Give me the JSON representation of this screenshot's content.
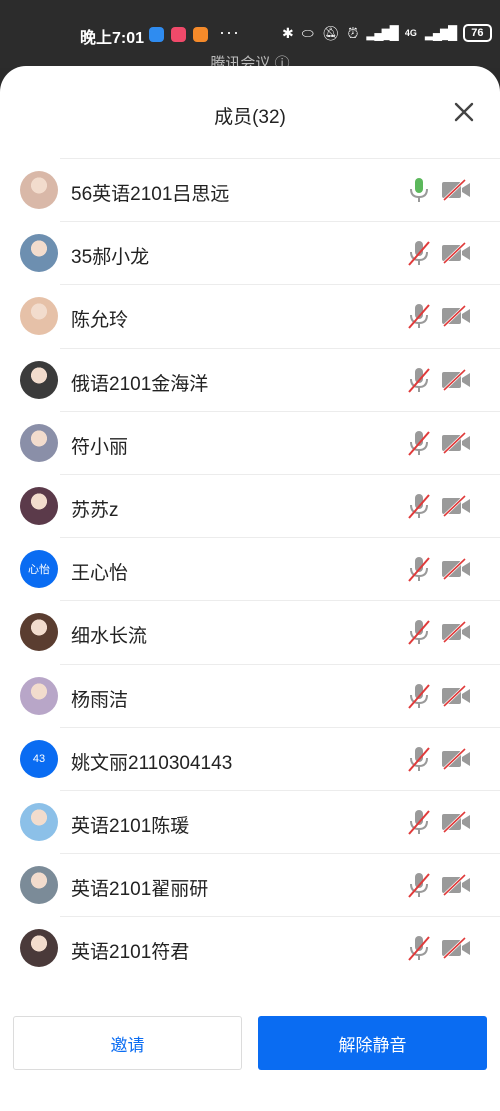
{
  "status_bar": {
    "time": "晚上7:01",
    "dots": "···",
    "network": "4G",
    "battery": "76"
  },
  "background_title": "腾讯会议 ⓘ",
  "panel": {
    "title": "成员(32)",
    "close_icon": "close-icon"
  },
  "members": [
    {
      "name": "56英语2101吕思远",
      "mic": "on",
      "camera": "off",
      "avatar_color": "#d9b8a8",
      "host_badge": true
    },
    {
      "name": "35郝小龙",
      "mic": "muted",
      "camera": "off",
      "avatar_color": "#6d8fb0"
    },
    {
      "name": "陈允玲",
      "mic": "muted",
      "camera": "off",
      "avatar_color": "#e6c1a8"
    },
    {
      "name": "俄语2101金海洋",
      "mic": "muted",
      "camera": "off",
      "avatar_color": "#3b3b3b"
    },
    {
      "name": "符小丽",
      "mic": "muted",
      "camera": "off",
      "avatar_color": "#8a8fa8"
    },
    {
      "name": "苏苏z",
      "mic": "muted",
      "camera": "off",
      "avatar_color": "#5b3a4a"
    },
    {
      "name": "王心怡",
      "mic": "muted",
      "camera": "off",
      "avatar_text": "心怡",
      "avatar_color": "#0a6cf2"
    },
    {
      "name": "细水长流",
      "mic": "muted",
      "camera": "off",
      "avatar_color": "#5a3d30"
    },
    {
      "name": "杨雨洁",
      "mic": "muted",
      "camera": "off",
      "avatar_color": "#b8a6c8"
    },
    {
      "name": "姚文丽2110304143",
      "mic": "muted",
      "camera": "off",
      "avatar_text": "43",
      "avatar_color": "#0a6cf2"
    },
    {
      "name": "英语2101陈瑗",
      "mic": "muted",
      "camera": "off",
      "avatar_color": "#8cc0e8"
    },
    {
      "name": "英语2101翟丽研",
      "mic": "muted",
      "camera": "off",
      "avatar_color": "#7b8b98"
    },
    {
      "name": "英语2101符君",
      "mic": "muted",
      "camera": "off",
      "avatar_color": "#4a3a3a"
    }
  ],
  "buttons": {
    "invite": "邀请",
    "unmute_all": "解除静音"
  },
  "colors": {
    "accent": "#0a6cf2",
    "mic_on": "#5cb85c",
    "muted_slash": "#e03a3a",
    "icon_gray": "#9a9a9a"
  }
}
